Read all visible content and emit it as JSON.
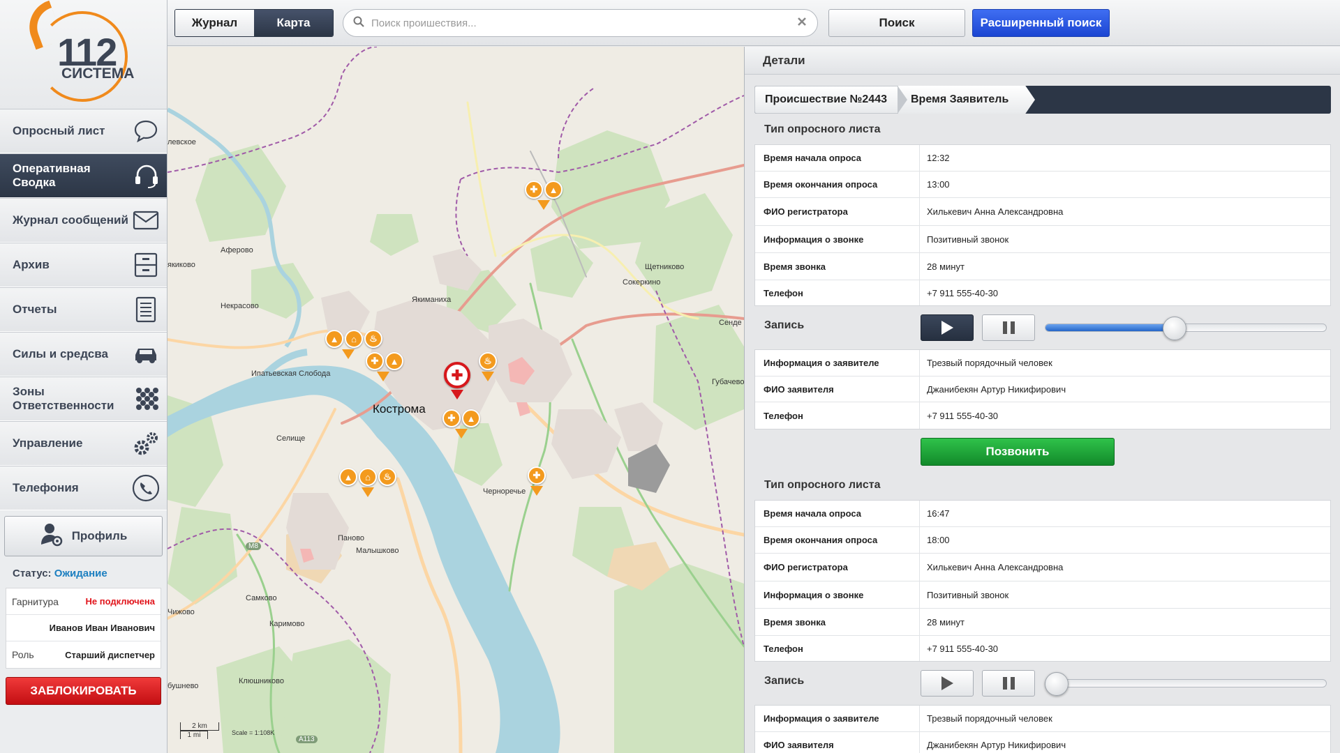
{
  "logo": {
    "number": "112",
    "word": "СИСТЕМА"
  },
  "nav": [
    {
      "label": "Опросный лист",
      "icon": "chat-bubble-icon",
      "active": false
    },
    {
      "label": "Оперативная Сводка",
      "icon": "headset-icon",
      "active": true
    },
    {
      "label": "Журнал сообщений",
      "icon": "envelope-icon",
      "active": false
    },
    {
      "label": "Архив",
      "icon": "archive-cabinet-icon",
      "active": false
    },
    {
      "label": "Отчеты",
      "icon": "document-icon",
      "active": false
    },
    {
      "label": "Силы и средсва",
      "icon": "car-icon",
      "active": false
    },
    {
      "label": "Зоны Ответственности",
      "icon": "grid-dots-icon",
      "active": false
    },
    {
      "label": "Управление",
      "icon": "gears-icon",
      "active": false
    },
    {
      "label": "Телефония",
      "icon": "phone-icon",
      "active": false
    }
  ],
  "profile": {
    "label": "Профиль"
  },
  "status": {
    "label": "Статус:",
    "value": "Ожидание"
  },
  "user_info": {
    "headset_label": "Гарнитура",
    "headset_value": "Не подключена",
    "name": "Иванов Иван Иванович",
    "role_label": "Роль",
    "role_value": "Старший диспетчер"
  },
  "lock_button": "ЗАБЛОКИРОВАТЬ",
  "topbar": {
    "tab_journal": "Журнал",
    "tab_map": "Карта",
    "active_tab": "Карта",
    "search_placeholder": "Поиск проишествия...",
    "search_button": "Поиск",
    "advanced_button": "Расширенный поиск"
  },
  "map": {
    "places": [
      "левское",
      "Аферово",
      "якиково",
      "Некрасово",
      "Якиманиха",
      "Щетниково",
      "Сокеркино",
      "Сенде",
      "Ипатьевская Слобода",
      "Кострома",
      "Губачево",
      "Селище",
      "Черноречье",
      "Паново",
      "Малышково",
      "Самково",
      "Каримово",
      "Чижово",
      "Клюшниково",
      "бушнево",
      "М8",
      "A113"
    ],
    "scale_km": "2 km",
    "scale_mi": "1 mi",
    "scale_text": "Scale = 1:108K"
  },
  "details": {
    "header": "Детали",
    "breadcrumb": [
      "Происшествие №2443",
      "Время Заявитель"
    ],
    "call_button": "Позвонить",
    "record_label": "Запись",
    "surveys": [
      {
        "title": "Тип опросного листа",
        "rows": [
          {
            "k": "Время начала опроса",
            "v": "12:32"
          },
          {
            "k": "Время окончания опроса",
            "v": "13:00"
          },
          {
            "k": "ФИО регистратора",
            "v": "Хилькевич Анна Александровна"
          },
          {
            "k": "Информация о звонке",
            "v": "Позитивный звонок"
          },
          {
            "k": "Время звонка",
            "v": "28 минут"
          },
          {
            "k": "Телефон",
            "v": "+7 911 555-40-30"
          }
        ],
        "record_progress": 0.46,
        "playing": true,
        "applicant": [
          {
            "k": "Информация о заявителе",
            "v": "Трезвый порядочный человек"
          },
          {
            "k": "ФИО заявителя",
            "v": "Джанибекян Артур Никифирович"
          },
          {
            "k": "Телефон",
            "v": "+7 911 555-40-30"
          }
        ]
      },
      {
        "title": "Тип опросного листа",
        "rows": [
          {
            "k": "Время начала опроса",
            "v": "16:47"
          },
          {
            "k": "Время окончания опроса",
            "v": "18:00"
          },
          {
            "k": "ФИО регистратора",
            "v": "Хилькевич Анна Александровна"
          },
          {
            "k": "Информация о звонке",
            "v": "Позитивный звонок"
          },
          {
            "k": "Время звонка",
            "v": "28 минут"
          },
          {
            "k": "Телефон",
            "v": "+7 911 555-40-30"
          }
        ],
        "record_progress": 0.0,
        "playing": false,
        "applicant": [
          {
            "k": "Информация о заявителе",
            "v": "Трезвый порядочный человек"
          },
          {
            "k": "ФИО заявителя",
            "v": "Джанибекян Артур Никифирович"
          }
        ]
      }
    ]
  },
  "colors": {
    "accent_orange": "#f08a1c",
    "dark": "#2c3646",
    "blue": "#1b45d2",
    "green": "#128a2a",
    "red": "#c30e12"
  }
}
